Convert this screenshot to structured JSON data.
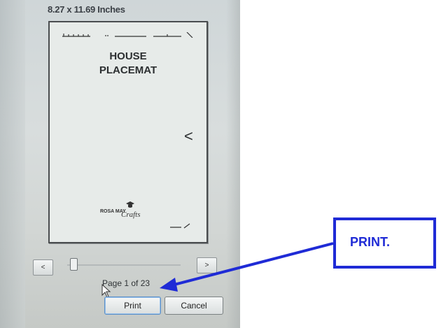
{
  "dialog": {
    "paper_size": "8.27 x 11.69 Inches",
    "page_status": "Page 1 of 23",
    "prev_label": "<",
    "next_label": ">",
    "print_label": "Print",
    "cancel_label": "Cancel",
    "page_slider_value": 1,
    "page_slider_max": 23
  },
  "preview": {
    "title_line1": "HOUSE",
    "title_line2": "PLACEMAT",
    "chevron": "<",
    "logo_text": "ROSA MAY",
    "logo_script": "Crafts"
  },
  "annotation": {
    "callout_label": "PRINT.",
    "color": "#1f2bd6"
  },
  "icons": [
    "cursor-icon",
    "chevron-left-icon",
    "arrow-icon"
  ]
}
